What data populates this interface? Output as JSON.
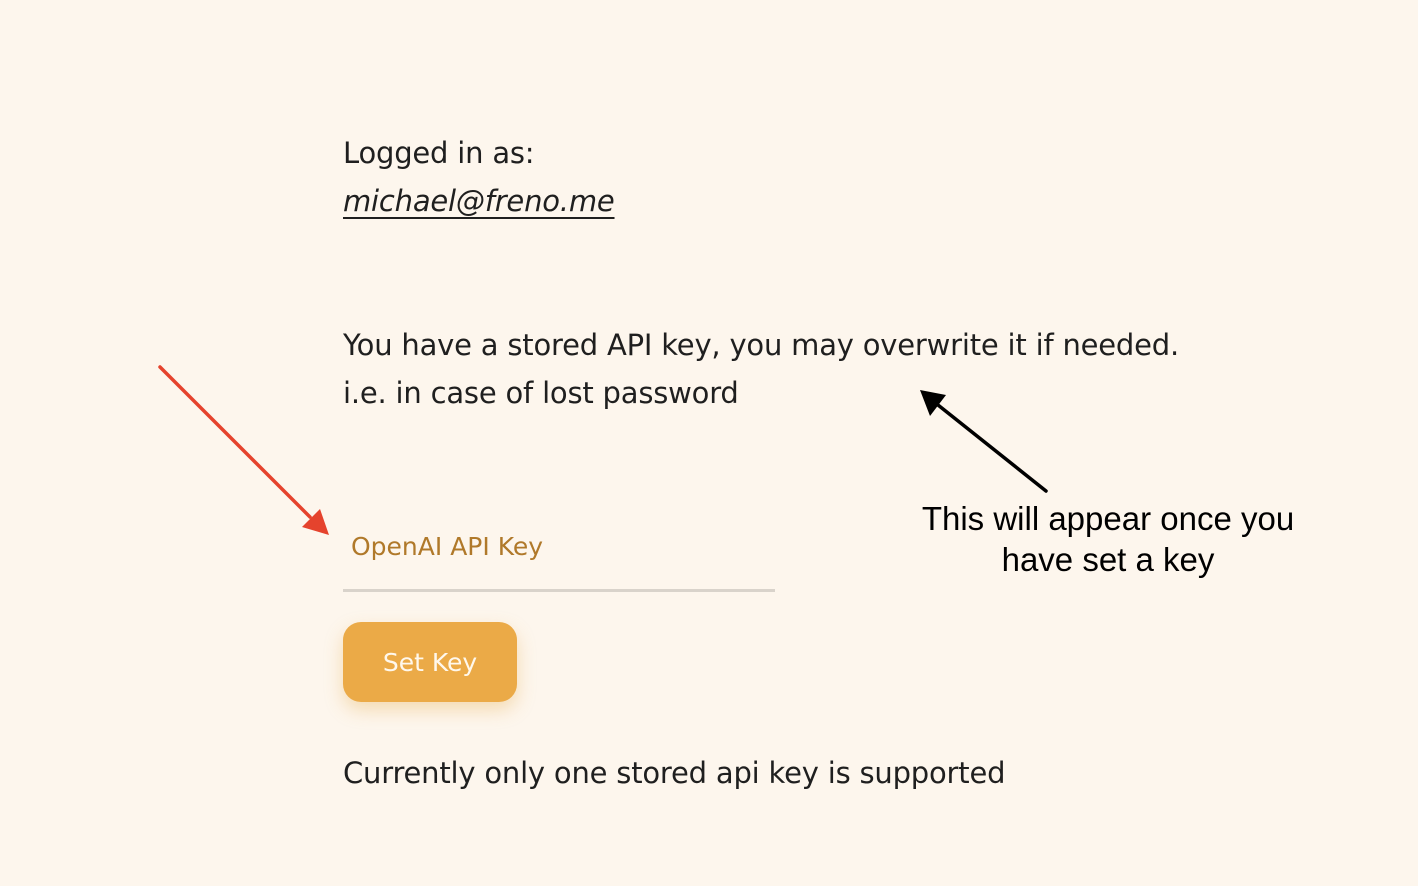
{
  "account": {
    "logged_in_label": "Logged in as:",
    "email": "michael@freno.me"
  },
  "notice": {
    "line1": "You have a stored API key, you may overwrite it if needed.",
    "line2": "i.e. in case of lost password"
  },
  "form": {
    "api_key_placeholder": "OpenAI API Key",
    "api_key_value": "",
    "submit_label": "Set Key"
  },
  "footnote": "Currently only one stored api key is supported",
  "annotation": {
    "line1": "This will appear once you",
    "line2": "have set a key"
  },
  "colors": {
    "background": "#fdf6ed",
    "accent": "#ebaa47",
    "placeholder": "#b0792a",
    "red_arrow": "#e5432d",
    "black_arrow": "#000000"
  }
}
